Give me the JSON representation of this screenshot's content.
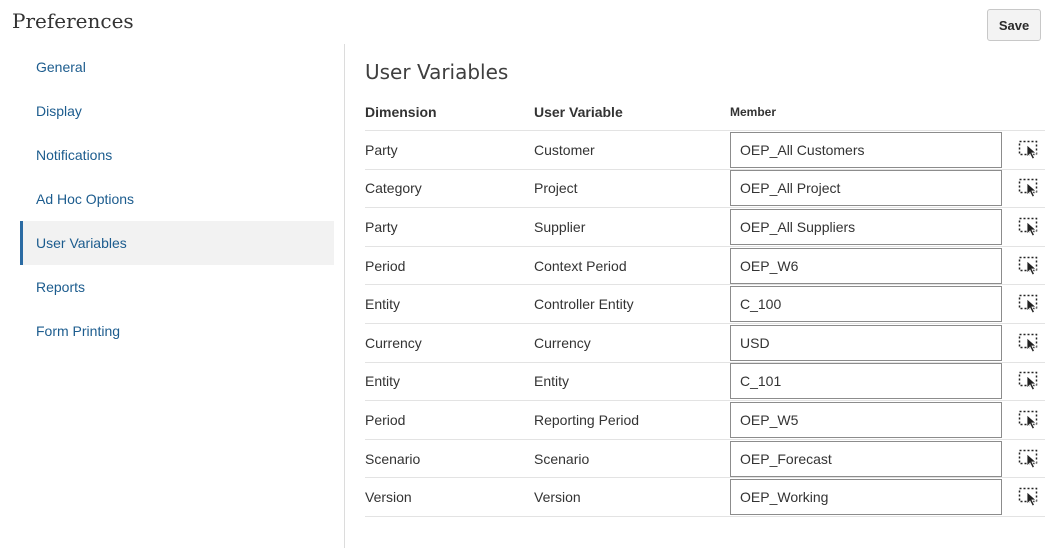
{
  "header": {
    "title": "Preferences",
    "save_label": "Save"
  },
  "sidebar": {
    "items": [
      {
        "label": "General",
        "active": false
      },
      {
        "label": "Display",
        "active": false
      },
      {
        "label": "Notifications",
        "active": false
      },
      {
        "label": "Ad Hoc Options",
        "active": false
      },
      {
        "label": "User Variables",
        "active": true
      },
      {
        "label": "Reports",
        "active": false
      },
      {
        "label": "Form Printing",
        "active": false
      }
    ]
  },
  "main": {
    "title": "User Variables",
    "columns": [
      "Dimension",
      "User Variable",
      "Member"
    ],
    "rows": [
      {
        "dimension": "Party",
        "variable": "Customer",
        "member": "OEP_All Customers"
      },
      {
        "dimension": "Category",
        "variable": "Project",
        "member": "OEP_All Project"
      },
      {
        "dimension": "Party",
        "variable": "Supplier",
        "member": "OEP_All Suppliers"
      },
      {
        "dimension": "Period",
        "variable": "Context Period",
        "member": "OEP_W6"
      },
      {
        "dimension": "Entity",
        "variable": "Controller Entity",
        "member": "C_100"
      },
      {
        "dimension": "Currency",
        "variable": "Currency",
        "member": "USD"
      },
      {
        "dimension": "Entity",
        "variable": "Entity",
        "member": "C_101"
      },
      {
        "dimension": "Period",
        "variable": "Reporting Period",
        "member": "OEP_W5"
      },
      {
        "dimension": "Scenario",
        "variable": "Scenario",
        "member": "OEP_Forecast"
      },
      {
        "dimension": "Version",
        "variable": "Version",
        "member": "OEP_Working"
      }
    ],
    "picker_icon": "member-selector-icon"
  }
}
